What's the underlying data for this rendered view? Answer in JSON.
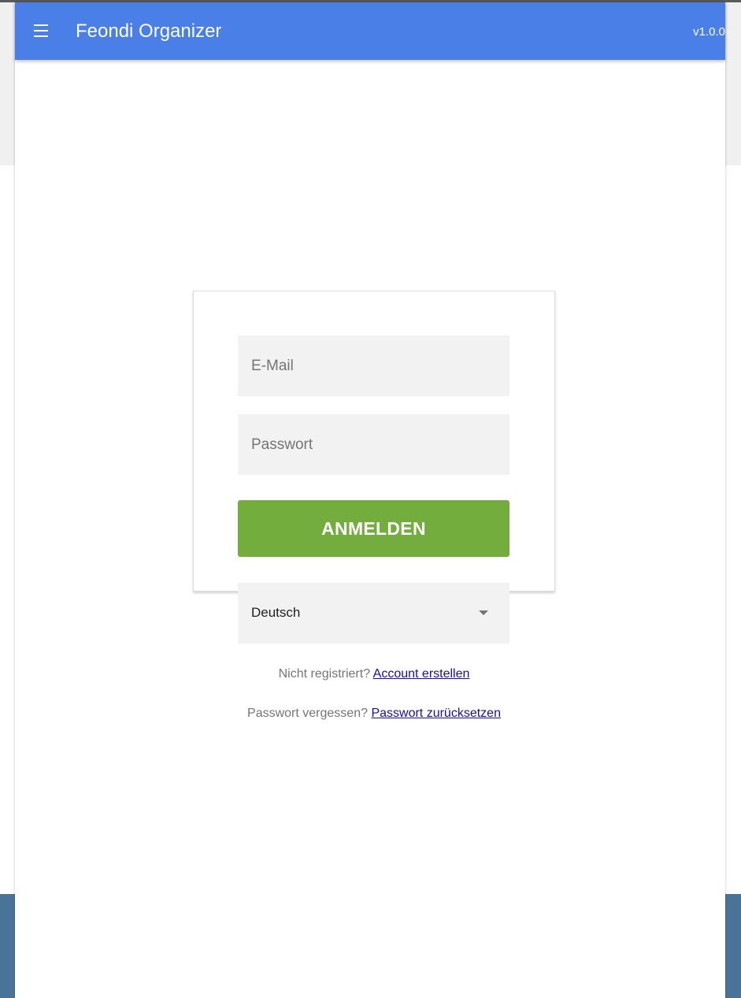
{
  "app_bar": {
    "title": "Feondi Organizer",
    "version": "v1.0.0"
  },
  "login": {
    "email_placeholder": "E-Mail",
    "password_placeholder": "Passwort",
    "submit_label": "ANMELDEN",
    "language_selected": "Deutsch",
    "register_prompt": "Nicht registriert?",
    "register_link": "Account erstellen",
    "forgot_prompt": "Passwort vergessen?",
    "forgot_link": "Passwort zurücksetzen"
  },
  "colors": {
    "app_bar": "#4a7fe8",
    "primary_button": "#72ad3d",
    "field_background": "#f2f2f2",
    "link": "#1a0dab"
  }
}
